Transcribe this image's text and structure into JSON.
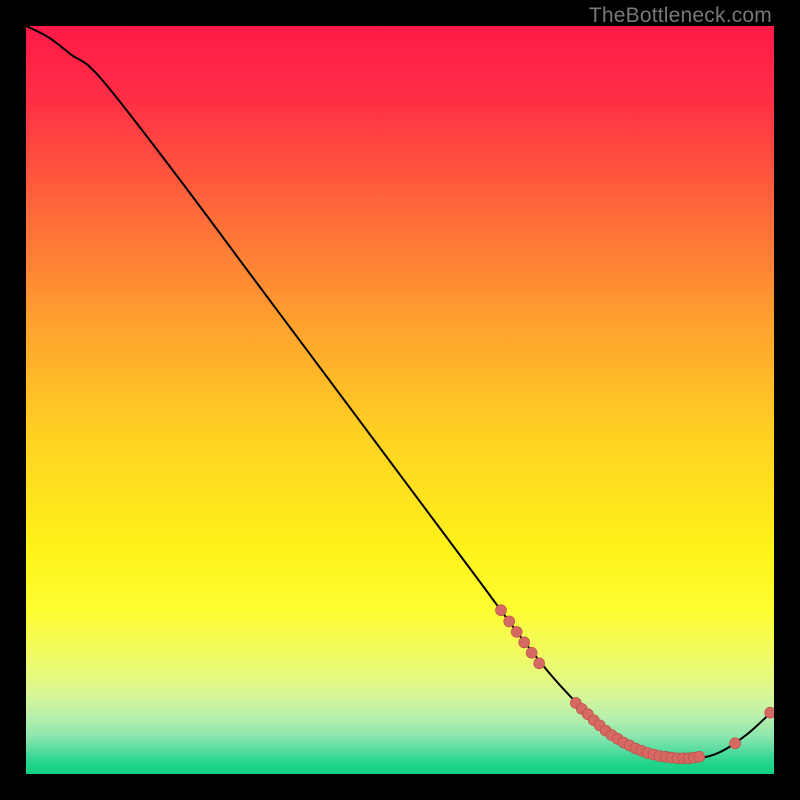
{
  "watermark": "TheBottleneck.com",
  "colors": {
    "bg_black": "#000000",
    "curve_stroke": "#000000",
    "marker_fill": "#d66a62",
    "marker_stroke": "#b74d46"
  },
  "chart_data": {
    "type": "line",
    "title": "",
    "xlabel": "",
    "ylabel": "",
    "xlim": [
      0,
      100
    ],
    "ylim": [
      0,
      100
    ],
    "grid": false,
    "legend": false,
    "curve": {
      "x": [
        0,
        3,
        6,
        10,
        20,
        30,
        40,
        50,
        60,
        67,
        72,
        77,
        82,
        85,
        88,
        92,
        96,
        100
      ],
      "y": [
        100,
        98.5,
        96.2,
        93.0,
        80.2,
        66.8,
        53.4,
        40.0,
        26.6,
        17.2,
        11.2,
        6.4,
        3.4,
        2.4,
        2.0,
        2.6,
        5.0,
        8.6
      ]
    },
    "markers_dense": {
      "x": [
        63.5,
        64.6,
        65.6,
        66.6,
        67.6,
        68.6,
        73.5,
        74.3,
        75.1,
        75.9,
        76.7,
        77.5,
        78.3,
        79.1,
        79.9,
        80.7,
        81.5,
        82.3,
        83.1,
        83.9,
        84.7,
        85.5,
        86.3,
        87.1,
        87.9,
        88.6,
        89.3,
        90.0
      ],
      "y": [
        21.9,
        20.4,
        19.0,
        17.6,
        16.2,
        14.8,
        9.5,
        8.7,
        8.0,
        7.2,
        6.5,
        5.8,
        5.2,
        4.7,
        4.2,
        3.8,
        3.4,
        3.1,
        2.8,
        2.6,
        2.4,
        2.3,
        2.2,
        2.1,
        2.1,
        2.1,
        2.2,
        2.3
      ]
    },
    "markers_sparse": {
      "x": [
        94.8,
        99.5
      ],
      "y": [
        4.1,
        8.2
      ]
    }
  }
}
